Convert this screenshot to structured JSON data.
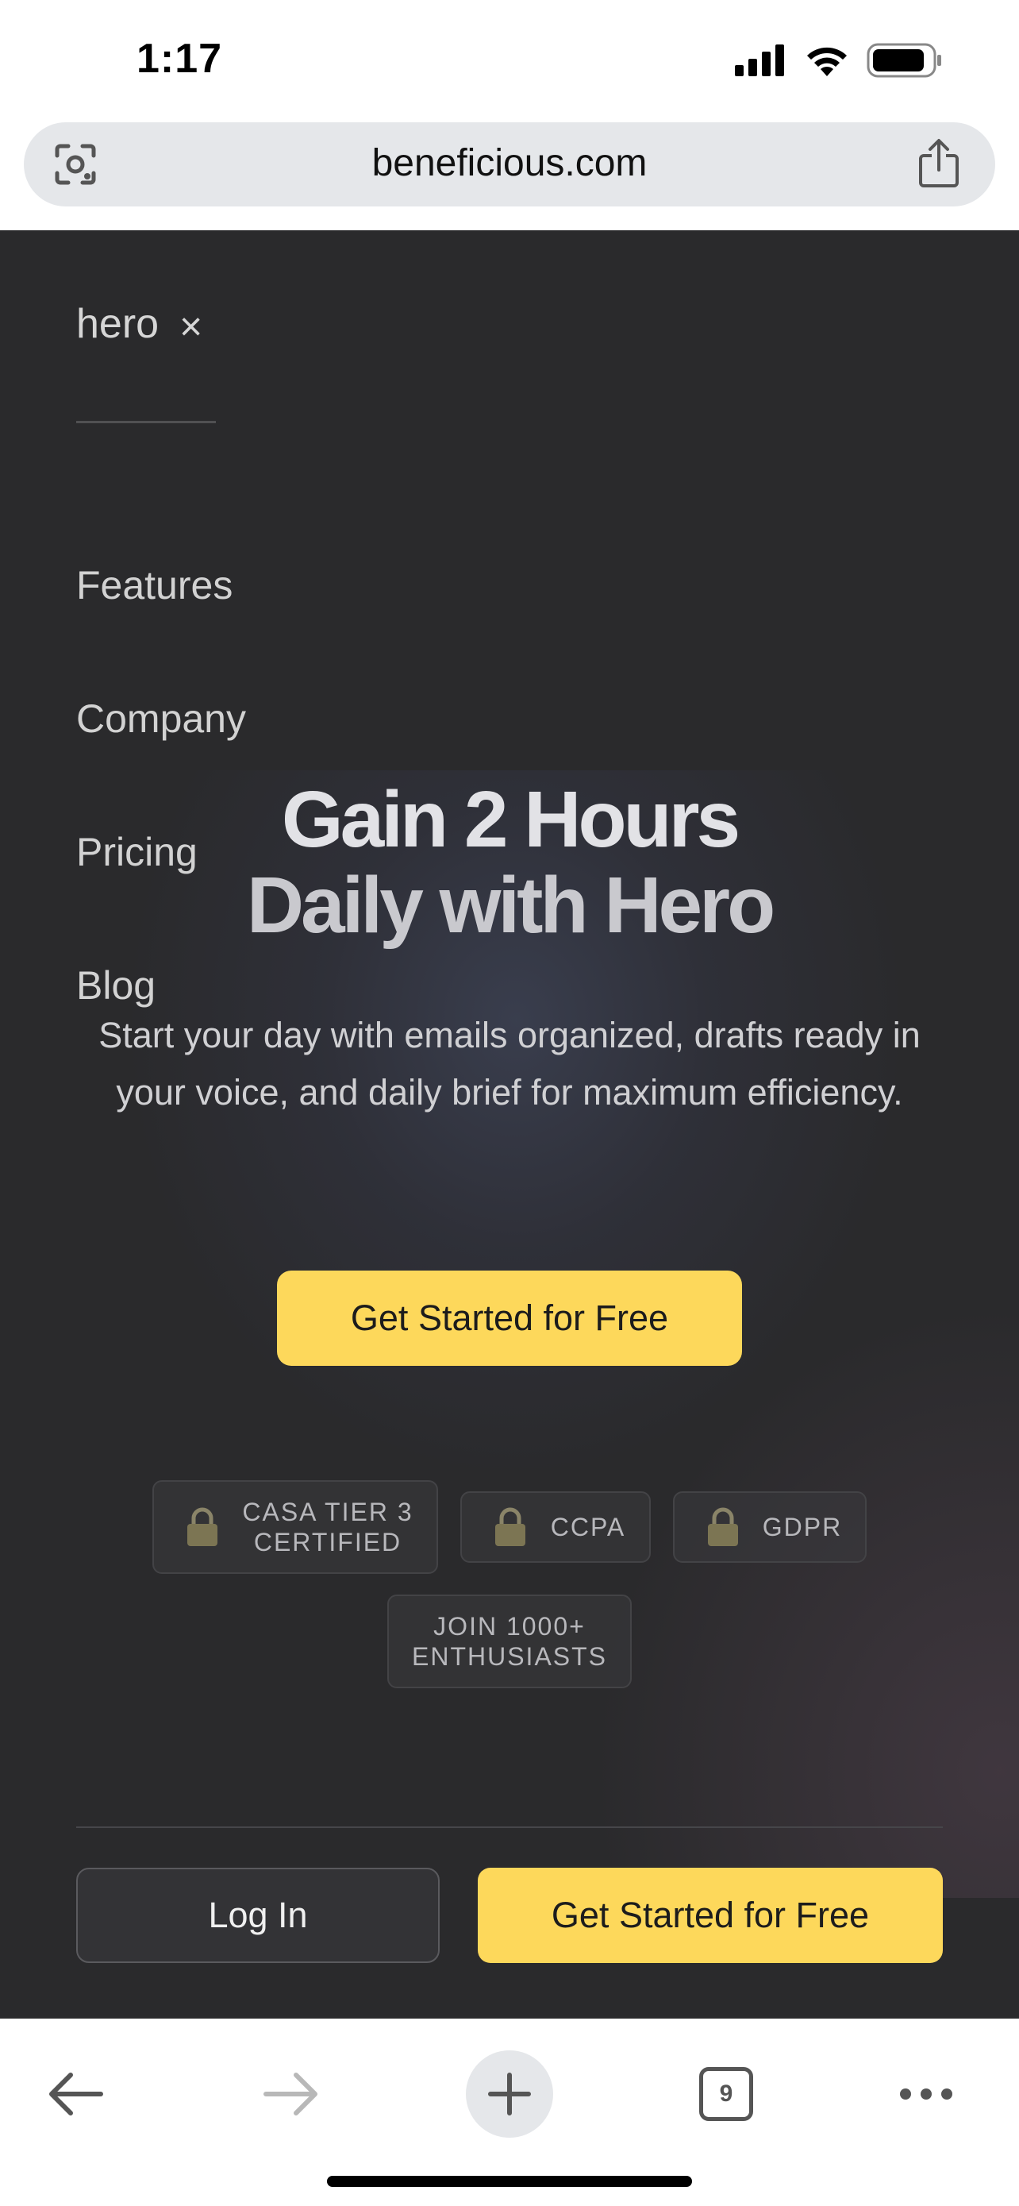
{
  "status_bar": {
    "time": "1:17"
  },
  "browser": {
    "url": "beneficious.com"
  },
  "menu": {
    "brand": "hero",
    "close_symbol": "×",
    "items": [
      {
        "label": "Features"
      },
      {
        "label": "Company"
      },
      {
        "label": "Pricing"
      },
      {
        "label": "Blog"
      }
    ]
  },
  "hero": {
    "title_line1": "Gain 2 Hours",
    "title_line2": "Daily with Hero",
    "subtitle": "Start your day with emails organized, drafts ready in your voice, and daily brief for maximum efficiency.",
    "cta_label": "Get Started for Free"
  },
  "badges": [
    {
      "label": "CASA TIER 3 CERTIFIED",
      "icon": "lock-icon"
    },
    {
      "label": "CCPA",
      "icon": "lock-icon"
    },
    {
      "label": "GDPR",
      "icon": "lock-icon"
    },
    {
      "label": "JOIN 1000+ ENTHUSIASTS"
    }
  ],
  "footer_actions": {
    "login_label": "Log In",
    "start_label": "Get Started for Free"
  },
  "toolbar": {
    "tab_count": "9"
  },
  "colors": {
    "accent": "#fdd85b",
    "page_background": "#2a2a2c",
    "browser_chrome": "#ffffff"
  }
}
